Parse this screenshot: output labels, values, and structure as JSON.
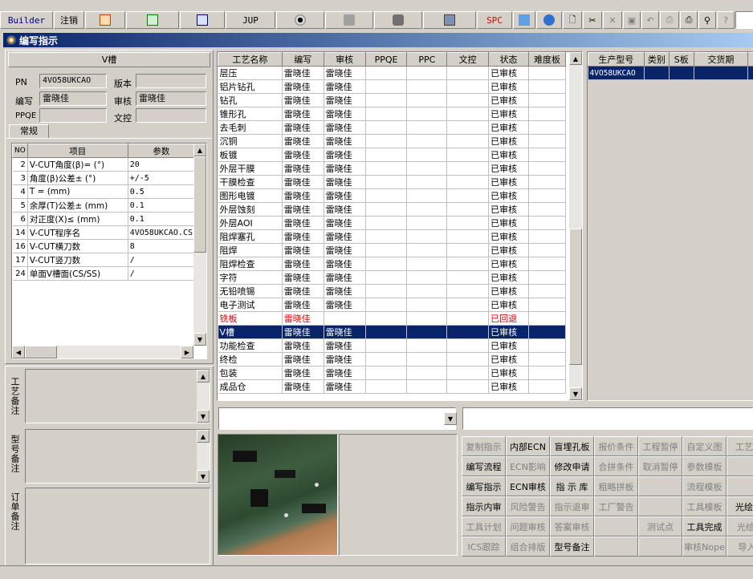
{
  "toolbar": {
    "builder_label": "Builder",
    "logout_label": "注销",
    "jup_label": "JUP",
    "spc_label": "SPC"
  },
  "window": {
    "title": "编写指示"
  },
  "left": {
    "section_title": "V槽",
    "pn_label": "PN",
    "pn_value": "4VO58UKCAO",
    "version_label": "版本",
    "version_value": "",
    "writer_label": "编写",
    "writer_value": "雷晓佳",
    "review_label": "审核",
    "review_value": "雷晓佳",
    "ppqe_label": "PPQE",
    "ppqe_value": "",
    "wenkong_label": "文控",
    "wenkong_value": "",
    "tab_label": "常规",
    "param_headers": [
      "NO",
      "项目",
      "参数"
    ],
    "params": [
      {
        "no": "2",
        "item": "V-CUT角度(β)=  (°)",
        "val": "20"
      },
      {
        "no": "3",
        "item": "角度(β)公差±  (°)",
        "val": "+/-5"
      },
      {
        "no": "4",
        "item": "T =  (mm)",
        "val": "0.5"
      },
      {
        "no": "5",
        "item": "余厚(T)公差±  (mm)",
        "val": "0.1"
      },
      {
        "no": "6",
        "item": "对正度(X)≤ (mm)",
        "val": "0.1"
      },
      {
        "no": "14",
        "item": "V-CUT程序名",
        "val": "4VO58UKCAO.CS"
      },
      {
        "no": "16",
        "item": "V-CUT横刀数",
        "val": "8"
      },
      {
        "no": "17",
        "item": "V-CUT竖刀数",
        "val": "/"
      },
      {
        "no": "24",
        "item": "单面V槽面(CS/SS)",
        "val": "/"
      }
    ],
    "remark_labels": [
      "工艺备注",
      "型号备注",
      "订单备注"
    ]
  },
  "process": {
    "headers": [
      "工艺名称",
      "编写",
      "审核",
      "PPQE",
      "PPC",
      "文控",
      "状态",
      "难度板"
    ],
    "rows": [
      {
        "name": "层压",
        "writer": "雷晓佳",
        "review": "雷晓佳",
        "status": "已审核"
      },
      {
        "name": "铝片钻孔",
        "writer": "雷晓佳",
        "review": "雷晓佳",
        "status": "已审核"
      },
      {
        "name": "钻孔",
        "writer": "雷晓佳",
        "review": "雷晓佳",
        "status": "已审核"
      },
      {
        "name": "锥形孔",
        "writer": "雷晓佳",
        "review": "雷晓佳",
        "status": "已审核"
      },
      {
        "name": "去毛刺",
        "writer": "雷晓佳",
        "review": "雷晓佳",
        "status": "已审核"
      },
      {
        "name": "沉铜",
        "writer": "雷晓佳",
        "review": "雷晓佳",
        "status": "已审核"
      },
      {
        "name": "板镀",
        "writer": "雷晓佳",
        "review": "雷晓佳",
        "status": "已审核"
      },
      {
        "name": "外层干膜",
        "writer": "雷晓佳",
        "review": "雷晓佳",
        "status": "已审核"
      },
      {
        "name": "干膜检查",
        "writer": "雷晓佳",
        "review": "雷晓佳",
        "status": "已审核"
      },
      {
        "name": "图形电镀",
        "writer": "雷晓佳",
        "review": "雷晓佳",
        "status": "已审核"
      },
      {
        "name": "外层蚀刻",
        "writer": "雷晓佳",
        "review": "雷晓佳",
        "status": "已审核"
      },
      {
        "name": "外层AOI",
        "writer": "雷晓佳",
        "review": "雷晓佳",
        "status": "已审核"
      },
      {
        "name": "阻焊塞孔",
        "writer": "雷晓佳",
        "review": "雷晓佳",
        "status": "已审核"
      },
      {
        "name": "阻焊",
        "writer": "雷晓佳",
        "review": "雷晓佳",
        "status": "已审核"
      },
      {
        "name": "阻焊检查",
        "writer": "雷晓佳",
        "review": "雷晓佳",
        "status": "已审核"
      },
      {
        "name": "字符",
        "writer": "雷晓佳",
        "review": "雷晓佳",
        "status": "已审核"
      },
      {
        "name": "无铅喷锡",
        "writer": "雷晓佳",
        "review": "雷晓佳",
        "status": "已审核"
      },
      {
        "name": "电子测试",
        "writer": "雷晓佳",
        "review": "雷晓佳",
        "status": "已审核"
      },
      {
        "name": "铣板",
        "writer": "雷晓佳",
        "review": "",
        "status": "已回退",
        "state": "returned"
      },
      {
        "name": "V槽",
        "writer": "雷晓佳",
        "review": "雷晓佳",
        "status": "已审核",
        "state": "selected"
      },
      {
        "name": "功能检查",
        "writer": "雷晓佳",
        "review": "雷晓佳",
        "status": "已审核"
      },
      {
        "name": "终检",
        "writer": "雷晓佳",
        "review": "雷晓佳",
        "status": "已审核"
      },
      {
        "name": "包装",
        "writer": "雷晓佳",
        "review": "雷晓佳",
        "status": "已审核"
      },
      {
        "name": "成品仓",
        "writer": "雷晓佳",
        "review": "雷晓佳",
        "status": "已审核"
      }
    ]
  },
  "right": {
    "headers": [
      "生产型号",
      "类别",
      "S板",
      "交货期"
    ],
    "rows": [
      {
        "model": "4VO58UKCAO"
      }
    ]
  },
  "colors": {
    "selected": "#0a246a",
    "returned": "#e00000",
    "titlebar": "#0a246a"
  },
  "buttons": [
    [
      {
        "label": "复制指示",
        "on": false
      },
      {
        "label": "内部ECN",
        "on": true
      },
      {
        "label": "盲埋孔板",
        "on": true
      },
      {
        "label": "报价条件",
        "on": false
      },
      {
        "label": "工程暂停",
        "on": false
      },
      {
        "label": "自定义图",
        "on": false
      },
      {
        "label": "工艺读",
        "on": false
      }
    ],
    [
      {
        "label": "编写流程",
        "on": true
      },
      {
        "label": "ECN影响",
        "on": false
      },
      {
        "label": "修改申请",
        "on": true
      },
      {
        "label": "合拼条件",
        "on": false
      },
      {
        "label": "取消暂停",
        "on": false
      },
      {
        "label": "参数模板",
        "on": false
      },
      {
        "label": "",
        "on": false
      }
    ],
    [
      {
        "label": "编写指示",
        "on": true
      },
      {
        "label": "ECN审核",
        "on": true
      },
      {
        "label": "指 示 库",
        "on": true
      },
      {
        "label": "粗略拼板",
        "on": false
      },
      {
        "label": "",
        "on": false
      },
      {
        "label": "流程模板",
        "on": false
      },
      {
        "label": "",
        "on": false
      }
    ],
    [
      {
        "label": "指示内审",
        "on": true
      },
      {
        "label": "风险警告",
        "on": false
      },
      {
        "label": "指示退审",
        "on": false
      },
      {
        "label": "工厂警告",
        "on": false
      },
      {
        "label": "",
        "on": false
      },
      {
        "label": "工具模板",
        "on": false
      },
      {
        "label": "光绘申",
        "on": true
      }
    ],
    [
      {
        "label": "工具计划",
        "on": false
      },
      {
        "label": "问题审核",
        "on": false
      },
      {
        "label": "答案审核",
        "on": false
      },
      {
        "label": "",
        "on": false
      },
      {
        "label": "测试点",
        "on": false
      },
      {
        "label": "工具完成",
        "on": true
      },
      {
        "label": "光绘E",
        "on": false
      }
    ],
    [
      {
        "label": "ICS跟踪",
        "on": false
      },
      {
        "label": "组合排版",
        "on": false
      },
      {
        "label": "型号备注",
        "on": true
      },
      {
        "label": "",
        "on": false
      },
      {
        "label": "",
        "on": false
      },
      {
        "label": "审核Nope",
        "on": false
      },
      {
        "label": "导入(",
        "on": false
      }
    ]
  ]
}
